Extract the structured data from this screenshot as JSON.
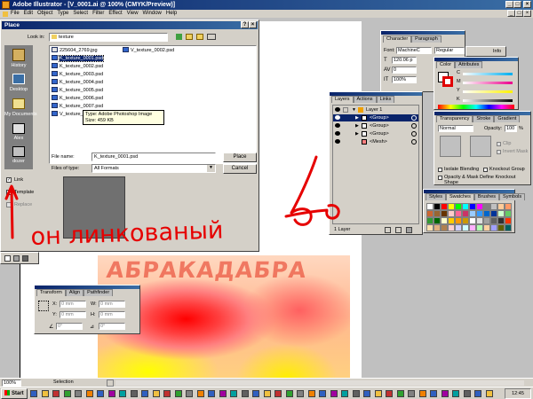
{
  "app": {
    "title": "Adobe Illustrator - [V_0001.ai @ 100% (CMYK/Preview)]",
    "menu": [
      "File",
      "Edit",
      "Object",
      "Type",
      "Select",
      "Filter",
      "Effect",
      "View",
      "Window",
      "Help"
    ]
  },
  "place_dialog": {
    "title": "Place",
    "look_in_label": "Look in:",
    "look_in_value": "texture",
    "sidebar": [
      {
        "label": "History",
        "icon": "history-icon"
      },
      {
        "label": "Desktop",
        "icon": "desktop-icon"
      },
      {
        "label": "My Documents",
        "icon": "my-documents-icon"
      },
      {
        "label": "Alex",
        "icon": "user-folder-icon"
      },
      {
        "label": "dozer",
        "icon": "network-icon"
      }
    ],
    "files_col1": [
      "225604_2769.jpg",
      "K_texture_0001.psd",
      "K_texture_0002.psd",
      "K_texture_0003.psd",
      "K_texture_0004.psd",
      "K_texture_0005.psd",
      "K_texture_0006.psd",
      "K_texture_0007.psd",
      "V_texture_0001.psd"
    ],
    "files_col2": [
      "V_texture_0002.psd"
    ],
    "selected_file": "K_texture_0001.psd",
    "tooltip_type": "Type: Adobe Photoshop Image",
    "tooltip_size": "Size: 459 KB",
    "file_name_label": "File name:",
    "file_name_value": "K_texture_0001.psd",
    "files_of_type_label": "Files of type:",
    "files_of_type_value": "All Formats",
    "place_button": "Place",
    "cancel_button": "Cancel",
    "link_label": "Link",
    "template_label": "Template",
    "replace_label": "Replace",
    "link_checked": true
  },
  "character_panel": {
    "tabs": [
      "Character",
      "Paragraph"
    ],
    "font_label": "Font:",
    "font_value": "MachineC",
    "style_value": "Regular",
    "size_value": "120.06 p",
    "leading_value": "0",
    "tracking_value": "100%",
    "extra_tab": "Info"
  },
  "color_panel": {
    "tabs": [
      "Color",
      "Attributes"
    ],
    "channels": [
      "C",
      "M",
      "Y",
      "K"
    ]
  },
  "layers_panel": {
    "tabs": [
      "Layers",
      "Actions",
      "Links"
    ],
    "layers": [
      "Layer 1",
      "<Group>",
      "<Group>",
      "<Group>",
      "<Mesh>"
    ],
    "footer": "1 Layer"
  },
  "transparency_panel": {
    "tabs": [
      "Transparency",
      "Stroke",
      "Gradient"
    ],
    "mode": "Normal",
    "opacity_label": "Opacity:",
    "opacity_value": "100",
    "opacity_unit": "%",
    "clip_label": "Clip",
    "invert_label": "Invert Mask",
    "isolate_label": "Isolate Blending",
    "knockout_label": "Knockout Group",
    "define_label": "Opacity & Mask Define Knockout Shape"
  },
  "swatches_panel": {
    "tabs": [
      "Styles",
      "Swatches",
      "Brushes",
      "Symbols"
    ],
    "colors": [
      "#ffffff",
      "#000000",
      "#ff0000",
      "#ffff00",
      "#00ff00",
      "#00ffff",
      "#0000ff",
      "#ff00ff",
      "#808080",
      "#c0c0c0",
      "#ffcc99",
      "#ff9966",
      "#cc6633",
      "#996633",
      "#663300",
      "#ffcccc",
      "#ff6699",
      "#cc3366",
      "#99ccff",
      "#3399ff",
      "#0066cc",
      "#003399",
      "#ccffcc",
      "#66cc66",
      "#339933",
      "#006600",
      "#ffffcc",
      "#ffcc00",
      "#ff9900",
      "#cc9900",
      "#ffffff",
      "#e0e0e0",
      "#a0a0a0",
      "#606060",
      "#303030",
      "#ff3300",
      "#ffe0b0",
      "#e0b080",
      "#b08050",
      "#ffd0d0",
      "#d0d0ff",
      "#d0ffff",
      "#ffb0ff",
      "#b0ffb0",
      "#ffd0a0",
      "#a0a0ff",
      "#606000",
      "#006060"
    ]
  },
  "transform_panel": {
    "tabs": [
      "Transform",
      "Align",
      "Pathfinder"
    ],
    "x_label": "X:",
    "x_value": "0 mm",
    "y_label": "Y:",
    "y_value": "0 mm",
    "w_label": "W:",
    "w_value": "0 mm",
    "h_label": "H:",
    "h_value": "0 mm",
    "angle_value": "0°",
    "shear_value": "0°"
  },
  "artwork": {
    "title_text": "АБРАКАДАБРА"
  },
  "annotation": {
    "text": "он линкованый",
    "color": "#e60000"
  },
  "status_bar": {
    "zoom": "100%",
    "tool": "Selection"
  },
  "taskbar": {
    "start": "Start",
    "clock": "12:45"
  }
}
